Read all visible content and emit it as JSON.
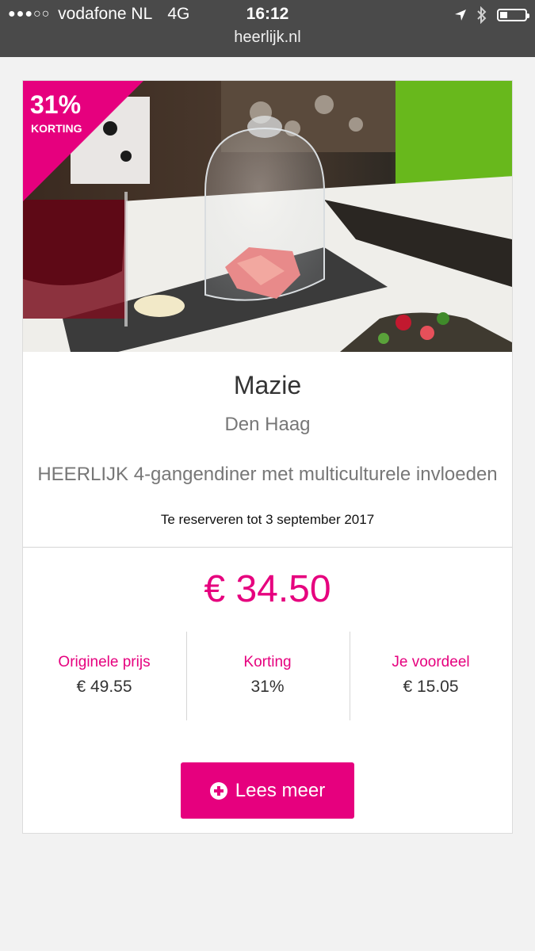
{
  "status_bar": {
    "signal_dots": "●●●○○",
    "carrier": "vodafone NL",
    "network": "4G",
    "time": "16:12",
    "url": "heerlijk.nl",
    "icons": [
      "location-arrow-icon",
      "bluetooth-icon",
      "battery-icon"
    ]
  },
  "deal": {
    "badge": {
      "percent": "31%",
      "label": "KORTING"
    },
    "name": "Mazie",
    "city": "Den Haag",
    "description": "HEERLIJK 4-gangendiner met multiculturele invloeden",
    "reserve_until": "Te reserveren tot 3 september 2017",
    "price": "€ 34.50",
    "stats": [
      {
        "label": "Originele prijs",
        "value": "€ 49.55"
      },
      {
        "label": "Korting",
        "value": "31%"
      },
      {
        "label": "Je voordeel",
        "value": "€ 15.05"
      }
    ],
    "button_label": "Lees meer",
    "button_icon": "plus-circle-icon"
  },
  "colors": {
    "accent": "#e6007e",
    "status_bar": "#4a4a4a",
    "page_background": "#f2f2f2"
  }
}
